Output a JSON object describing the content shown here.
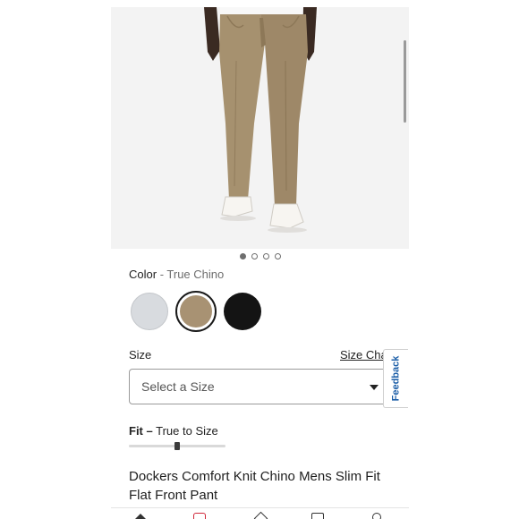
{
  "product": {
    "title": "Dockers Comfort Knit Chino Mens Slim Fit Flat Front Pant"
  },
  "gallery": {
    "dots": [
      true,
      false,
      false,
      false
    ]
  },
  "color": {
    "label": "Color",
    "separator": " - ",
    "selected": "True Chino",
    "swatches": [
      {
        "name": "light-grey",
        "hex": "#d8dbdf",
        "selected": false
      },
      {
        "name": "true-chino",
        "hex": "#a89273",
        "selected": true
      },
      {
        "name": "black",
        "hex": "#141414",
        "selected": false
      }
    ]
  },
  "size": {
    "label": "Size",
    "chart_link": "Size Chart",
    "placeholder": "Select a Size"
  },
  "fit": {
    "label": "Fit –",
    "value": "True to Size",
    "level": 0.5
  },
  "feedback": {
    "label": "Feedback"
  },
  "colors": {
    "accent_red": "#d0283a",
    "feedback_blue": "#1d5fa8",
    "pant_khaki": "#a6916f"
  }
}
